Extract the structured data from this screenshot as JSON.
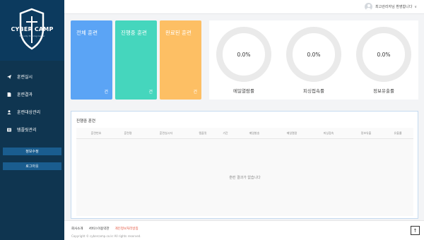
{
  "brand": {
    "name": "CYBER CAMP",
    "subtitle": "Security Training Center"
  },
  "menu": [
    {
      "label": "훈련실시",
      "icon": "send-icon"
    },
    {
      "label": "훈련결과",
      "icon": "document-icon"
    },
    {
      "label": "훈련대상관리",
      "icon": "user-icon"
    },
    {
      "label": "템플릿관리",
      "icon": "template-icon"
    }
  ],
  "side_buttons": {
    "profile": "정보수정",
    "logout": "로그아웃"
  },
  "topbar": {
    "user_greeting": "최고관리자님 환영합니다",
    "caret": "∨"
  },
  "cards": [
    {
      "title": "전체 훈련",
      "unit": "건",
      "color": "#5ba4f5"
    },
    {
      "title": "진행중 훈련",
      "unit": "건",
      "color": "#45d6bd"
    },
    {
      "title": "완료된 훈련",
      "unit": "건",
      "color": "#fdbf64"
    }
  ],
  "stats": [
    {
      "value": "0.0%",
      "label": "메일열람률"
    },
    {
      "value": "0.0%",
      "label": "피싱접속률"
    },
    {
      "value": "0.0%",
      "label": "정보유출률"
    }
  ],
  "table": {
    "title": "진행중 훈련",
    "columns": [
      "훈련번호",
      "훈련명",
      "훈련실시자",
      "템플릿",
      "기간",
      "메일발송",
      "메일열람",
      "피싱접속",
      "정보유출",
      "유출률"
    ],
    "empty_message": "훈련 결과가 없습니다"
  },
  "footer": {
    "links": [
      "회사소개",
      "서비스이용약관",
      "개인정보처리방침"
    ],
    "copyright": "Copyright © cybercamp.co.kr All rights reserved.",
    "top_button": "↑"
  }
}
